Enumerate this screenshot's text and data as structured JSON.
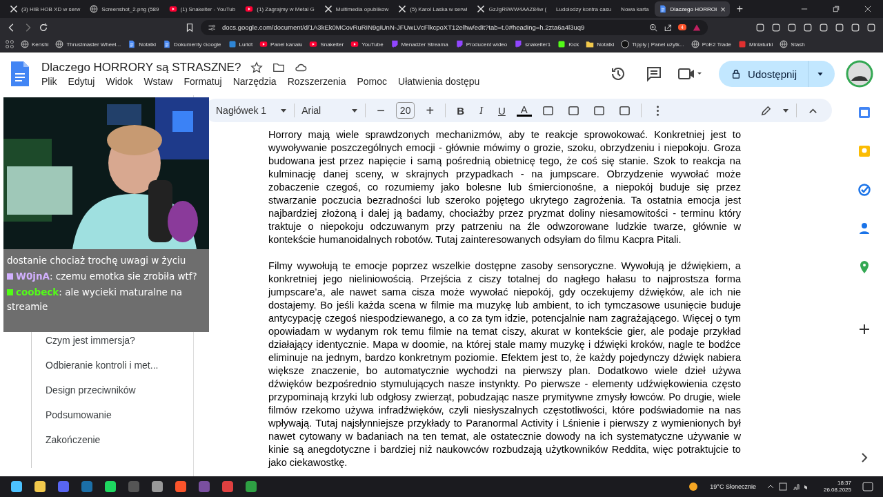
{
  "browser": {
    "tabs": [
      {
        "label": "(3) HIB HOB XD w serw",
        "selected": false
      },
      {
        "label": "Screenshot_2.png (589",
        "selected": false
      },
      {
        "label": "(1) Snakeiter - YouTub",
        "selected": false
      },
      {
        "label": "(1) Zagrajmy w Metal G",
        "selected": false
      },
      {
        "label": "Multimedia opublikow",
        "selected": false
      },
      {
        "label": "(5) Karol Laska w serwi",
        "selected": false
      },
      {
        "label": "GzJgR9WW4AAZ84w (",
        "selected": false
      },
      {
        "label": "Ludolodzy kontra casu",
        "selected": false
      },
      {
        "label": "Nowa karta",
        "selected": false
      },
      {
        "label": "Dlaczego HORROI",
        "selected": true
      }
    ],
    "close_tab": "×",
    "new_tab": "+",
    "url": "docs.google.com/document/d/1A3kEk0MCovRuRIN9giUnN-JFUwLVcFlkcpoXT12elhw/edit?tab=t.0#heading=h.2zta6a4l3uq9",
    "shield_badge": "4",
    "bookmarks": [
      "Kenshi",
      "Thrustmaster Wheel...",
      "Notatki",
      "Dokumenty Google",
      "Lurkit",
      "Panel kanału",
      "Snakeiter",
      "YouTube",
      "Menadżer Streama",
      "Producent wideo",
      "snakeiter1",
      "Kick",
      "Notatki",
      "Tipply | Panel użytk...",
      "PoE2 Trade",
      "Miniaturki",
      "Stash"
    ]
  },
  "document": {
    "title": "Dlaczego HORRORY są STRASZNE?",
    "menu": [
      "Plik",
      "Edytuj",
      "Widok",
      "Wstaw",
      "Formatuj",
      "Narzędzia",
      "Rozszerzenia",
      "Pomoc",
      "Ułatwienia dostępu"
    ],
    "share_button": "Udostępnij",
    "toolbar": {
      "style": "Nagłówek 1",
      "font": "Arial",
      "minus": "−",
      "size": "20",
      "plus": "+",
      "bold": "B",
      "italic": "I",
      "underline": "U",
      "text_color": "A"
    },
    "outline": [
      "Czym jest immersja?",
      "Odbieranie kontroli i met...",
      "Design przeciwników",
      "Podsumowanie",
      "Zakończenie"
    ],
    "paragraphs": [
      "Horrory mają wiele sprawdzonych mechanizmów, aby te reakcje sprowokować. Konkretniej jest to wywoływanie poszczególnych emocji - głównie mówimy o grozie, szoku, obrzydzeniu i niepokoju. Groza budowana jest przez napięcie i samą pośrednią obietnicę tego, że coś się stanie. Szok to reakcja na kulminację danej sceny, w skrajnych przypadkach - na jumpscare. Obrzydzenie wywołać może zobaczenie czegoś, co rozumiemy jako bolesne lub śmiercionośne, a niepokój buduje się przez stwarzanie poczucia bezradności lub szeroko pojętego ukrytego zagrożenia. Ta ostatnia emocja jest najbardziej złożoną i dalej ją badamy, chociażby przez pryzmat doliny niesamowitości - terminu który traktuje o niepokoju odczuwanym przy patrzeniu na źle odwzorowane ludzkie twarze, głównie w kontekście humanoidalnych robotów. Tutaj zainteresowanych odsyłam do filmu Kacpra Pitali.",
      "Filmy wywołują te emocje poprzez wszelkie dostępne zasoby sensoryczne. Wywołują je dźwiękiem, a konkretniej jego nieliniowością. Przejścia z ciszy totalnej do nagłego hałasu to najprostsza forma jumpscare’a, ale nawet sama cisza może wywołać niepokój, gdy oczekujemy dźwięków, ale ich nie dostajemy. Bo jeśli każda scena w filmie ma muzykę lub ambient, to ich tymczasowe usunięcie buduje antycypację czegoś niespodziewanego, a co za tym idzie, potencjalnie nam zagrażającego. Więcej o tym opowiadam w wydanym rok temu filmie na temat ciszy, akurat w kontekście gier, ale podaje przykład działający identycznie. Mapa w doomie, na której stale mamy muzykę i dźwięki kroków, nagle te bodźce eliminuje na jednym, bardzo konkretnym poziomie. Efektem jest to, że każdy pojedynczy dźwięk nabiera większe znaczenie, bo automatycznie wychodzi na pierwszy plan. Dodatkowo wiele dzieł używa dźwięków bezpośrednio stymulujących nasze instynkty. Po pierwsze - elementy udźwiękowienia często przypominają krzyki lub odgłosy zwierząt, pobudzając nasze prymitywne zmysły łowców. Po drugie, wiele filmów rzekomo używa infradźwięków, czyli niesłyszalnych częstotliwości, które podświadomie na nas wpływają. Tutaj najsłynniejsze przykłady to Paranormal Activity i Lśnienie i pierwszy z wymienionych był nawet cytowany w badaniach na ten temat, ale ostatecznie dowody na ich systematyczne używanie w kinie są anegdotyczne i bardziej niż naukowców rozbudzają użytkowników Reddita, więc potraktujcie to jako ciekawostkę."
    ]
  },
  "stream_overlay": {
    "chat": [
      {
        "text": "dostanie chociaż trochę uwagi w życiu"
      },
      {
        "user": "W0jnA",
        "color": "#d2b0ff",
        "text": ": czemu  emotka sie zrobiła wtf?"
      },
      {
        "user": "coobeck",
        "color": "#53fc18",
        "text": ": ale wycieki maturalne na streamie"
      }
    ]
  },
  "taskbar": {
    "weather": "19°C Słonecznie",
    "time": "18:37",
    "date": "26.08.2025"
  }
}
